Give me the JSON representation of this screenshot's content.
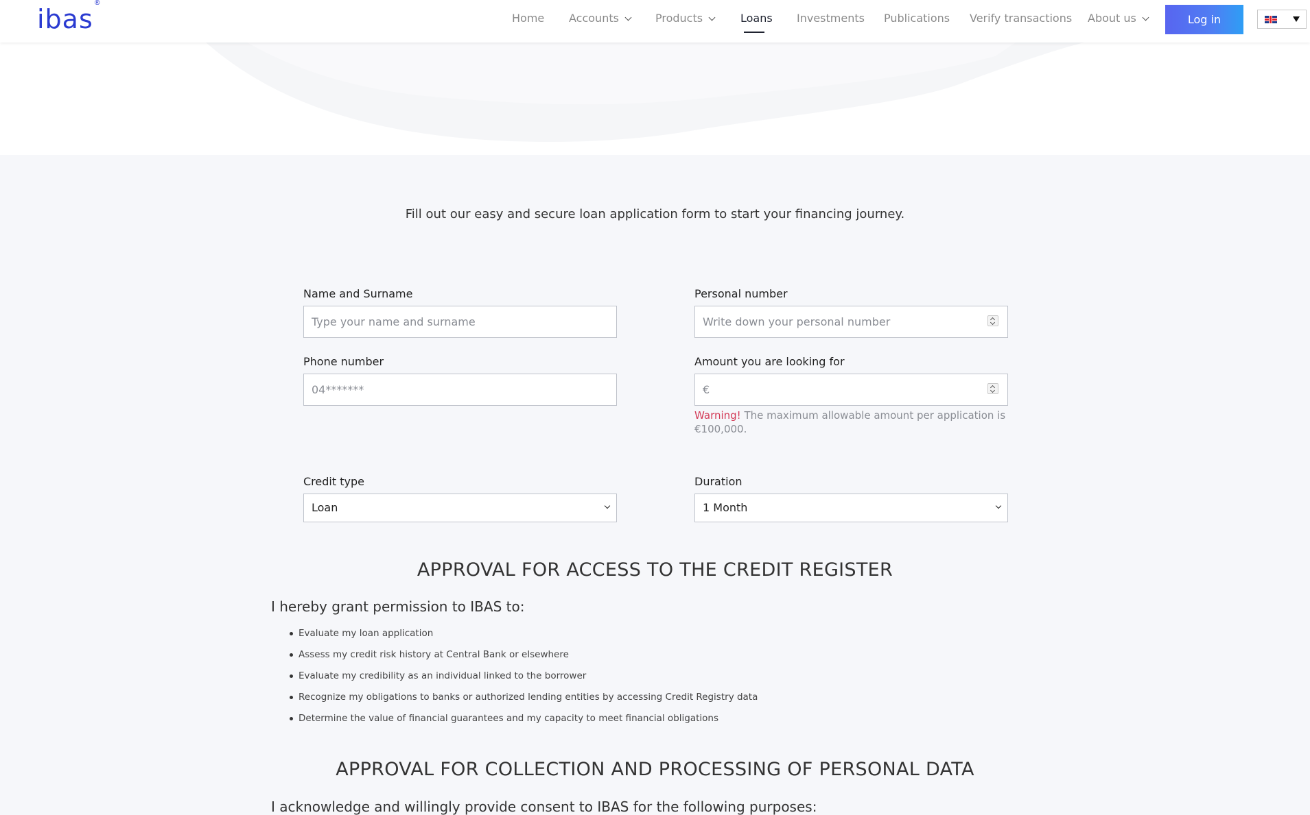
{
  "header": {
    "logo": "ibas",
    "logo_mark": "®",
    "nav": {
      "home": "Home",
      "accounts": "Accounts",
      "products": "Products",
      "loans": "Loans",
      "investments": "Investments",
      "publications": "Publications",
      "verify": "Verify transactions",
      "about": "About us"
    },
    "active_nav": "Loans",
    "login_label": "Log in",
    "language_icon": "uk-flag-icon"
  },
  "intro": "Fill out our easy and secure loan application form to start your financing journey.",
  "form": {
    "name": {
      "label": "Name and Surname",
      "placeholder": "Type your name and surname",
      "value": ""
    },
    "personal_number": {
      "label": "Personal number",
      "placeholder": "Write down your personal number",
      "value": ""
    },
    "phone": {
      "label": "Phone number",
      "placeholder": "04*******",
      "value": ""
    },
    "amount": {
      "label": "Amount you are looking for",
      "placeholder": "€",
      "value": ""
    },
    "warning_prefix": "Warning!",
    "warning_text": " The maximum allowable amount per application is €100,000.",
    "credit_type": {
      "label": "Credit type",
      "selected": "Loan"
    },
    "duration": {
      "label": "Duration",
      "selected": "1 Month"
    }
  },
  "credit_register": {
    "title": "APPROVAL FOR ACCESS TO THE CREDIT REGISTER",
    "lead": "I hereby grant permission to IBAS to:",
    "items": [
      "Evaluate my loan application",
      "Assess my credit risk history at Central Bank or elsewhere",
      "Evaluate my credibility as an individual linked to the borrower",
      "Recognize my obligations to banks or authorized lending entities by accessing Credit Registry data",
      "Determine the value of financial guarantees and my capacity to meet financial obligations"
    ]
  },
  "personal_data": {
    "title": "APPROVAL FOR COLLECTION AND PROCESSING OF PERSONAL DATA",
    "lead": "I acknowledge and willingly provide consent to IBAS for the following purposes:"
  },
  "colors": {
    "brand": "#2b3bd1",
    "button_gradient_start": "#5865f0",
    "button_gradient_end": "#2e9ef5",
    "warning": "#d33b57",
    "page_bg": "#f6f7fa"
  }
}
